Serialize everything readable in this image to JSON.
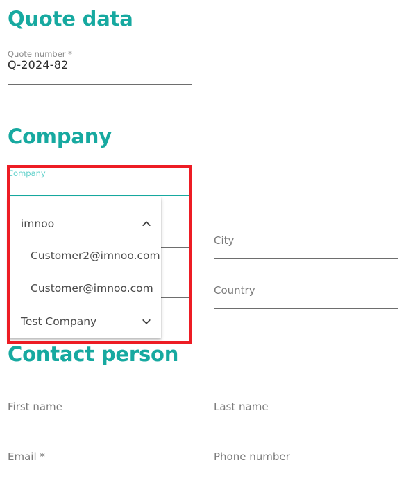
{
  "sections": {
    "quote_data_title": "Quote data",
    "company_title": "Company",
    "contact_person_title": "Contact person"
  },
  "fields": {
    "quote_number": {
      "label": "Quote number *",
      "value": "Q-2024-82"
    },
    "company": {
      "label": "Company",
      "value": ""
    },
    "city": {
      "label": "City",
      "value": ""
    },
    "country": {
      "label": "Country",
      "value": ""
    },
    "first_name": {
      "label": "First name",
      "value": ""
    },
    "last_name": {
      "label": "Last name",
      "value": ""
    },
    "email": {
      "label": "Email *",
      "value": ""
    },
    "phone_number": {
      "label": "Phone number",
      "value": ""
    }
  },
  "company_dropdown": {
    "expanded": true,
    "options": [
      {
        "label": "imnoo",
        "type": "group",
        "icon": "chevron-up-icon",
        "expanded": true
      },
      {
        "label": "Customer2@imnoo.com",
        "type": "child",
        "icon": "",
        "expanded": false
      },
      {
        "label": "Customer@imnoo.com",
        "type": "child",
        "icon": "",
        "expanded": false
      },
      {
        "label": "Test Company",
        "type": "group",
        "icon": "chevron-down-icon",
        "expanded": false
      }
    ]
  },
  "colors": {
    "accent_teal": "#17a9a0",
    "focus_label_teal": "#5fd0ca",
    "highlight_red": "#ed1c24",
    "label_gray": "#7b7b7b",
    "value_dark": "#2c2c2c"
  }
}
